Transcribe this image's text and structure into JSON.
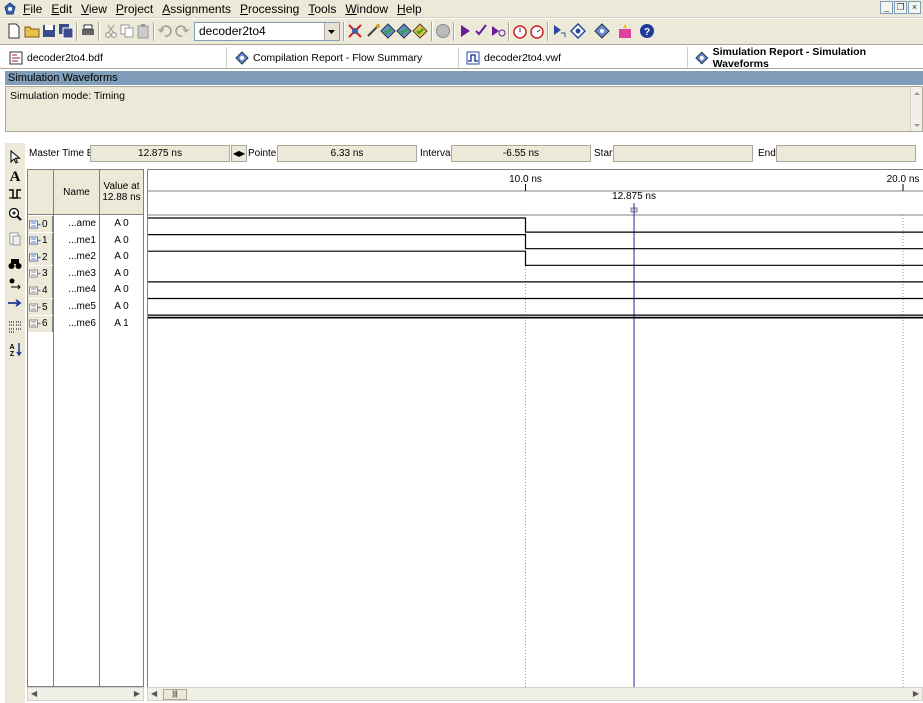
{
  "menu": {
    "items": [
      {
        "label": "File",
        "key": "F",
        "rest": "ile"
      },
      {
        "label": "Edit",
        "key": "E",
        "rest": "dit"
      },
      {
        "label": "View",
        "key": "V",
        "rest": "iew"
      },
      {
        "label": "Project",
        "key": "P",
        "rest": "roject"
      },
      {
        "label": "Assignments",
        "key": "A",
        "rest": "ssignments"
      },
      {
        "label": "Processing",
        "key": "P",
        "rest": "rocessing"
      },
      {
        "label": "Tools",
        "key": "T",
        "rest": "ools"
      },
      {
        "label": "Window",
        "key": "W",
        "rest": "indow"
      },
      {
        "label": "Help",
        "key": "H",
        "rest": "elp"
      }
    ],
    "window_controls": [
      "_",
      "Õ",
      "×"
    ]
  },
  "toolbar": {
    "project_value": "decoder2to4"
  },
  "tabs": [
    {
      "label": "decoder2to4.bdf",
      "icon": "bdf-file-icon",
      "active": false
    },
    {
      "label": "Compilation Report - Flow Summary",
      "icon": "report-icon",
      "active": false
    },
    {
      "label": "decoder2to4.vwf",
      "icon": "waveform-file-icon",
      "active": false
    },
    {
      "label": "Simulation Report - Simulation Waveforms",
      "icon": "report-icon",
      "active": true
    }
  ],
  "report": {
    "header": "Simulation Waveforms",
    "mode_text": "Simulation mode: Timing"
  },
  "timebar": {
    "master_label": "Master Time Bar:",
    "master_value": "12.875 ns",
    "pointer_label": "Pointer:",
    "pointer_value": "6.33 ns",
    "interval_label": "Interval:",
    "interval_value": "-6.55 ns",
    "start_label": "Start:",
    "start_value": "",
    "end_label": "End:",
    "end_value": ""
  },
  "table": {
    "col_name": "Name",
    "col_value_line1": "Value at",
    "col_value_line2": "12.88 ns",
    "signals": [
      {
        "index": "0",
        "name": "...ame",
        "value": "A 0",
        "dir": "in"
      },
      {
        "index": "1",
        "name": "...me1",
        "value": "A 0",
        "dir": "in"
      },
      {
        "index": "2",
        "name": "...me2",
        "value": "A 0",
        "dir": "in"
      },
      {
        "index": "3",
        "name": "...me3",
        "value": "A 0",
        "dir": "out"
      },
      {
        "index": "4",
        "name": "...me4",
        "value": "A 0",
        "dir": "out"
      },
      {
        "index": "5",
        "name": "...me5",
        "value": "A 0",
        "dir": "out"
      },
      {
        "index": "6",
        "name": "...me6",
        "value": "A 1",
        "dir": "out"
      }
    ]
  },
  "timeline": {
    "ruler_labels": [
      "10.0 ns",
      "20.0 ns"
    ],
    "cursor_label": "12.875 ns",
    "range_ns": [
      0,
      20
    ],
    "cursor_ns": 12.875,
    "grid_ns": [
      10,
      20
    ],
    "waves": [
      {
        "high_until_ns": 10,
        "low_after": true
      },
      {
        "high_until_ns": 10,
        "low_after": true
      },
      {
        "high_until_ns": 10,
        "low_after": true
      },
      {
        "level": 0
      },
      {
        "level": 0
      },
      {
        "level": 0
      },
      {
        "level": 1
      }
    ]
  },
  "colors": {
    "cursor": "#1e2a9c",
    "wave": "#000000",
    "grid": "#9a9a9a",
    "header_bar": "#7f9db9"
  }
}
